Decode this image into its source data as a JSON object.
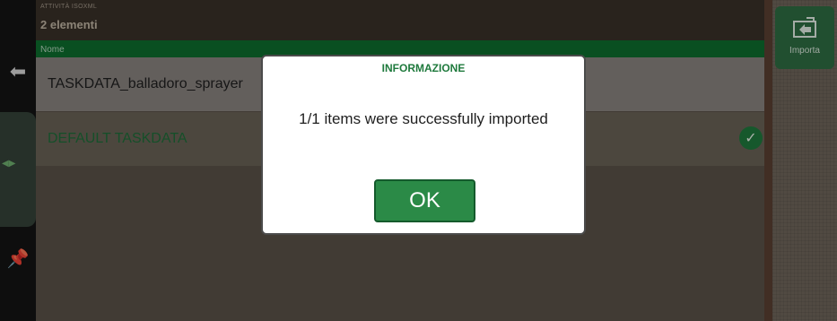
{
  "header": {
    "section_label": "ATTIVITÀ ISOXML",
    "count_text": "2 elementi",
    "column_name": "Nome"
  },
  "rows": [
    {
      "label": "TASKDATA_balladoro_sprayer",
      "selected": false
    },
    {
      "label": "DEFAULT TASKDATA",
      "selected": true
    }
  ],
  "sidebar": {
    "back_icon": "arrow-left-icon",
    "nozzle_icon": "nozzle-icon",
    "tool_icon": "tool-icon"
  },
  "actions": {
    "import_label": "Importa",
    "import_icon": "import-icon"
  },
  "dialog": {
    "title": "INFORMAZIONE",
    "message": "1/1 items were successfully imported",
    "ok_label": "OK"
  },
  "colors": {
    "accent_green": "#1f7a3d",
    "header_brown": "#3a3129",
    "dialog_border": "#4b4b4b"
  }
}
